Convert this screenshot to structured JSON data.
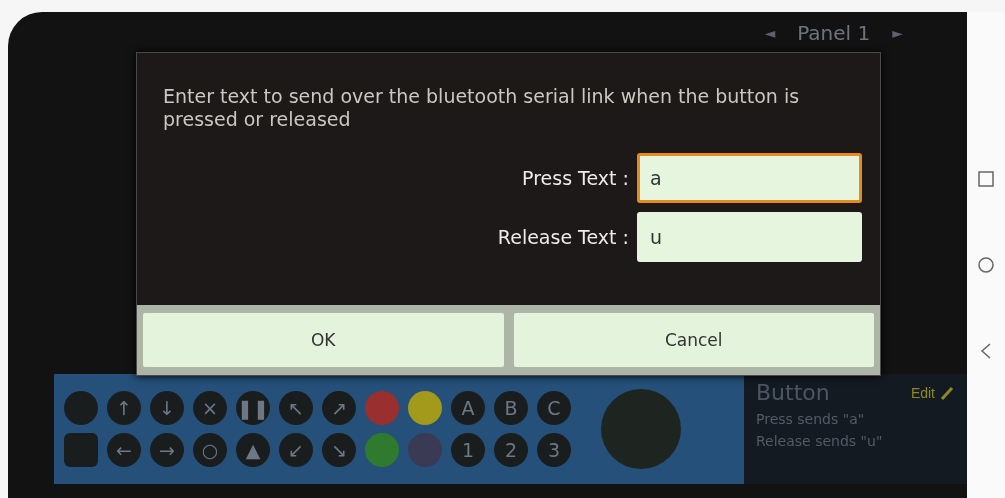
{
  "top_bar": {
    "prev": "◄",
    "panel": "Panel 1",
    "next": "►"
  },
  "palette": {
    "rows": [
      [
        {
          "kind": "blank"
        },
        {
          "kind": "glyph",
          "text": "↑"
        },
        {
          "kind": "glyph",
          "text": "↓"
        },
        {
          "kind": "glyph",
          "text": "×"
        },
        {
          "kind": "glyph",
          "text": "❚❚"
        },
        {
          "kind": "glyph",
          "text": "↖"
        },
        {
          "kind": "glyph",
          "text": "↗"
        },
        {
          "kind": "color",
          "color": "#9a2f2f"
        },
        {
          "kind": "color",
          "color": "#a39a1c"
        },
        {
          "kind": "glyph",
          "text": "A"
        },
        {
          "kind": "glyph",
          "text": "B"
        },
        {
          "kind": "glyph",
          "text": "C"
        }
      ],
      [
        {
          "kind": "square"
        },
        {
          "kind": "glyph",
          "text": "←"
        },
        {
          "kind": "glyph",
          "text": "→"
        },
        {
          "kind": "glyph",
          "text": "○"
        },
        {
          "kind": "glyph",
          "text": "▲"
        },
        {
          "kind": "glyph",
          "text": "↙"
        },
        {
          "kind": "glyph",
          "text": "↘"
        },
        {
          "kind": "color",
          "color": "#2f7a2f"
        },
        {
          "kind": "color",
          "color": "#3a3a55"
        },
        {
          "kind": "glyph",
          "text": "1"
        },
        {
          "kind": "glyph",
          "text": "2"
        },
        {
          "kind": "glyph",
          "text": "3"
        }
      ]
    ]
  },
  "info": {
    "title": "Button",
    "edit": "Edit",
    "lines": [
      "Press sends \"a\"",
      "Release sends \"u\""
    ]
  },
  "dialog": {
    "message": "Enter text to send over the bluetooth serial link when the button is pressed or released",
    "fields": [
      {
        "label": "Press Text :",
        "value": "a",
        "focused": true
      },
      {
        "label": "Release Text :",
        "value": "u",
        "focused": false
      }
    ],
    "buttons": [
      "OK",
      "Cancel"
    ]
  }
}
